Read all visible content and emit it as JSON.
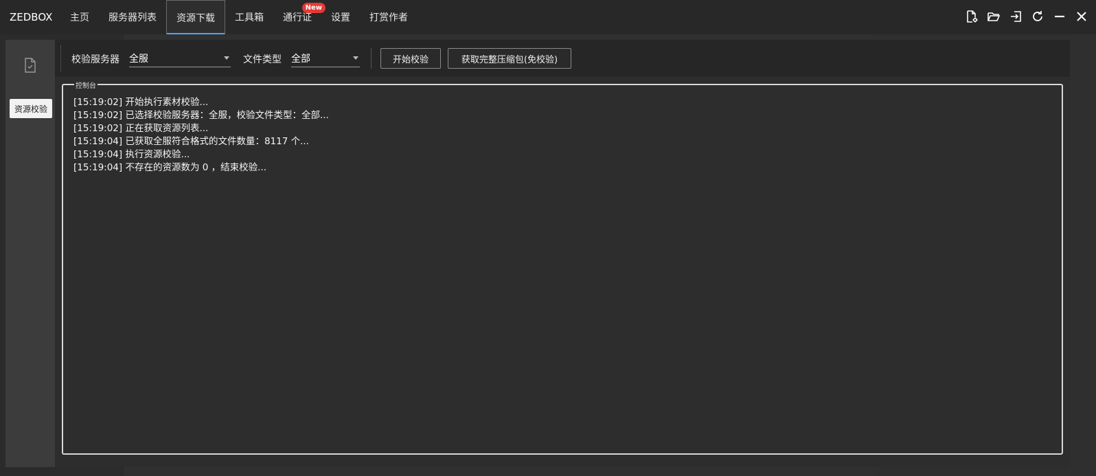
{
  "app": {
    "brand": "ZEDBOX"
  },
  "nav": {
    "tabs": [
      {
        "label": "主页"
      },
      {
        "label": "服务器列表"
      },
      {
        "label": "资源下载"
      },
      {
        "label": "工具箱"
      },
      {
        "label": "通行证",
        "badge": "New"
      },
      {
        "label": "设置"
      },
      {
        "label": "打赏作者"
      }
    ],
    "active_index": 2
  },
  "window_controls": [
    "file-settings-icon",
    "folder-open-icon",
    "exit-icon",
    "refresh-icon",
    "minimize-icon",
    "close-icon"
  ],
  "sidebar": {
    "icon": "document-check-icon",
    "button_label": "资源校验"
  },
  "toolbar": {
    "server_label": "校验服务器",
    "server_value": "全服",
    "filetype_label": "文件类型",
    "filetype_value": "全部",
    "start_button": "开始校验",
    "full_package_button": "获取完整压缩包(免校验)"
  },
  "console": {
    "title": "控制台",
    "lines": [
      "[15:19:02] 开始执行素材校验...",
      "[15:19:02] 已选择校验服务器：全服，校验文件类型：全部...",
      "[15:19:02] 正在获取资源列表...",
      "[15:19:04] 已获取全服符合格式的文件数量：8117 个...",
      "[15:19:04] 执行资源校验...",
      "[15:19:04] 不存在的资源数为 0 ，结束校验..."
    ]
  },
  "colors": {
    "accent": "#4da3ff",
    "badge": "#e53935"
  }
}
